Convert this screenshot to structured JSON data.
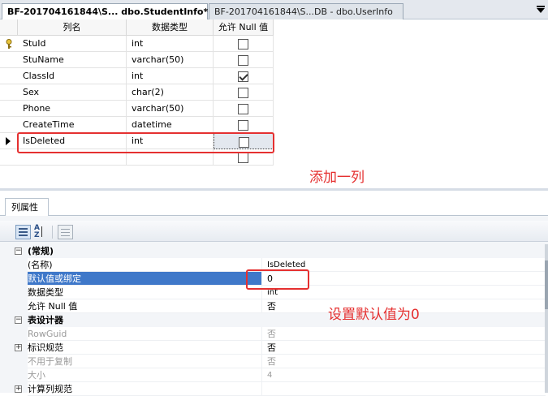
{
  "tabs": [
    {
      "label": "BF-201704161844\\S... dbo.StudentInfo*"
    },
    {
      "label": "BF-201704161844\\S...DB - dbo.UserInfo"
    }
  ],
  "grid": {
    "headers": [
      "列名",
      "数据类型",
      "允许 Null 值"
    ],
    "rows": [
      {
        "name": "StuId",
        "type": "int",
        "allow_null": false
      },
      {
        "name": "StuName",
        "type": "varchar(50)",
        "allow_null": false
      },
      {
        "name": "ClassId",
        "type": "int",
        "allow_null": true
      },
      {
        "name": "Sex",
        "type": "char(2)",
        "allow_null": false
      },
      {
        "name": "Phone",
        "type": "varchar(50)",
        "allow_null": false
      },
      {
        "name": "CreateTime",
        "type": "datetime",
        "allow_null": false
      },
      {
        "name": "IsDeleted",
        "type": "int",
        "allow_null": false
      }
    ]
  },
  "annotations": {
    "add_column": "添加一列",
    "set_default": "设置默认值为0"
  },
  "properties_tab": "列属性",
  "properties": {
    "general": "(常规)",
    "name_label": "(名称)",
    "name_value": "IsDeleted",
    "default_label": "默认值或绑定",
    "default_value": "0",
    "datatype_label": "数据类型",
    "datatype_value": "int",
    "allownull_label": "允许 Null 值",
    "allownull_value": "否",
    "table_designer": "表设计器",
    "rowguid_label": "RowGuid",
    "rowguid_value": "否",
    "identity_label": "标识规范",
    "identity_value": "否",
    "notrepl_label": "不用于复制",
    "notrepl_value": "否",
    "size_label": "大小",
    "size_value": "4",
    "computed_label": "计算列规范"
  },
  "colors": {
    "highlight": "#e53030",
    "selection": "#3f78c9"
  }
}
